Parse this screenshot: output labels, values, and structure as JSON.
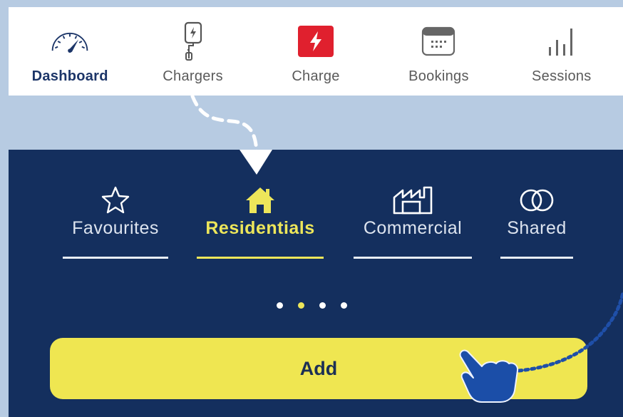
{
  "top_nav": {
    "items": [
      {
        "label": "Dashboard",
        "icon": "speedometer-icon",
        "active": true
      },
      {
        "label": "Chargers",
        "icon": "charger-plug-icon",
        "active": false
      },
      {
        "label": "Charge",
        "icon": "lightning-bolt-icon",
        "active": false
      },
      {
        "label": "Bookings",
        "icon": "calendar-icon",
        "active": false
      },
      {
        "label": "Sessions",
        "icon": "bar-chart-icon",
        "active": false
      }
    ]
  },
  "charger_tabs": {
    "items": [
      {
        "label": "Favourites",
        "icon": "star-icon",
        "active": false
      },
      {
        "label": "Residentials",
        "icon": "house-icon",
        "active": true
      },
      {
        "label": "Commercial",
        "icon": "factory-icon",
        "active": false
      },
      {
        "label": "Shared",
        "icon": "linked-rings-icon",
        "active": false
      }
    ]
  },
  "pager": {
    "count": 4,
    "active_index": 1
  },
  "actions": {
    "add_label": "Add"
  },
  "colors": {
    "panel_bg": "#142f5e",
    "page_bg": "#b7cbe2",
    "accent_yellow": "#ede65a",
    "charge_red": "#e0202e",
    "nav_active": "#1c3568"
  }
}
